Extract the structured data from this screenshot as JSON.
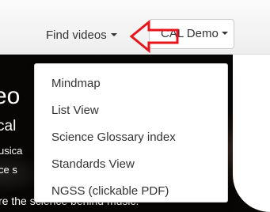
{
  "navbar": {
    "find_videos_label": "Find videos",
    "user_menu_label": "CAL Demo"
  },
  "dropdown": {
    "items": [
      {
        "label": "Mindmap"
      },
      {
        "label": "List View"
      },
      {
        "label": "Science Glossary index"
      },
      {
        "label": "Standards View"
      },
      {
        "label": "NGSS (clickable PDF)"
      }
    ]
  },
  "hero": {
    "title_fragment": "eo",
    "subtitle_fragment": "cal",
    "line1_fragment": "usica",
    "line2_fragment": "ce s",
    "line3_fragment": "re the science behind music."
  },
  "colors": {
    "annotation_arrow": "#e8141b",
    "hero_background": "#0b0a09",
    "menu_text": "#333333"
  },
  "icons": {
    "annotation": "red-arrow-icon",
    "dropdown_caret": "caret-down-icon"
  }
}
